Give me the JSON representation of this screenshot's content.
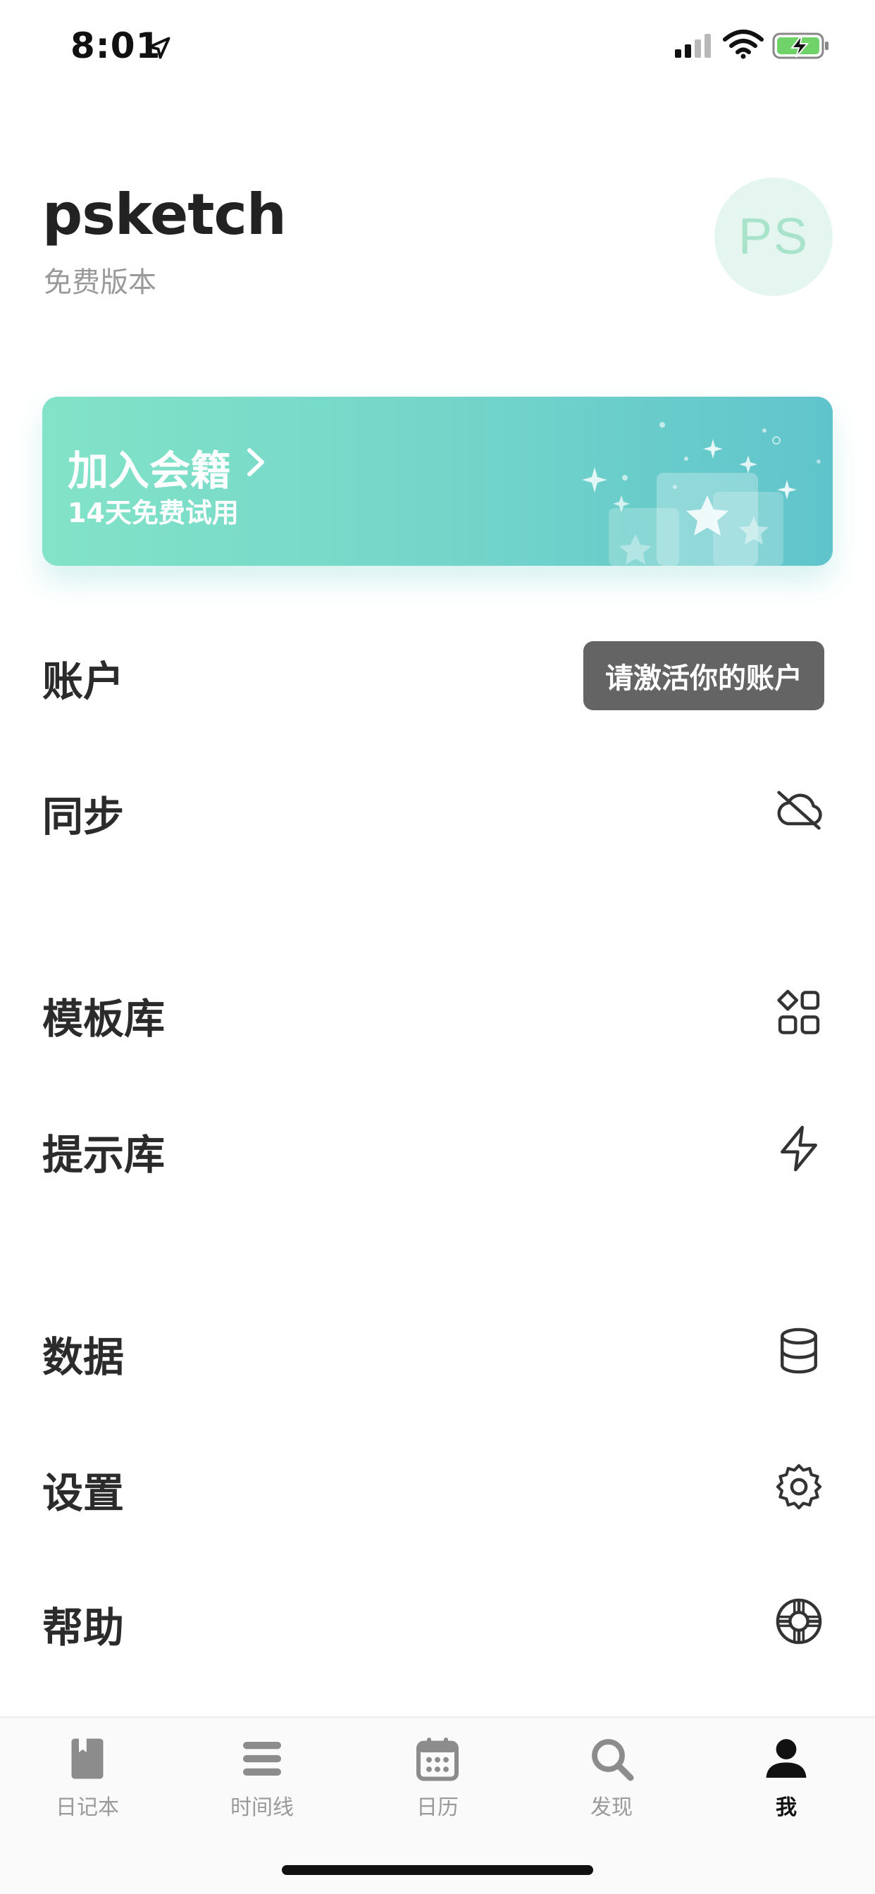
{
  "status_bar": {
    "time": "8:01"
  },
  "profile": {
    "username": "psketch",
    "tier": "免费版本",
    "avatar_initials": "PS"
  },
  "banner": {
    "title": "加入会籍",
    "subtitle": "14天免费试用"
  },
  "menu": {
    "account": {
      "label": "账户",
      "action": "请激活你的账户"
    },
    "sync": {
      "label": "同步",
      "icon": "cloud-off-icon"
    },
    "templates": {
      "label": "模板库",
      "icon": "grid-icon"
    },
    "prompts": {
      "label": "提示库",
      "icon": "lightning-icon"
    },
    "data": {
      "label": "数据",
      "icon": "database-icon"
    },
    "settings": {
      "label": "设置",
      "icon": "gear-icon"
    },
    "help": {
      "label": "帮助",
      "icon": "lifebuoy-icon"
    }
  },
  "tabs": [
    {
      "label": "日记本",
      "icon": "journal-icon"
    },
    {
      "label": "时间线",
      "icon": "timeline-icon"
    },
    {
      "label": "日历",
      "icon": "calendar-icon"
    },
    {
      "label": "发现",
      "icon": "search-icon"
    },
    {
      "label": "我",
      "icon": "profile-icon",
      "active": true
    }
  ],
  "colors": {
    "accent_start": "#82e3c8",
    "accent_end": "#60c4cc",
    "avatar_bg": "#e4f6ef",
    "button_bg": "#646464"
  }
}
